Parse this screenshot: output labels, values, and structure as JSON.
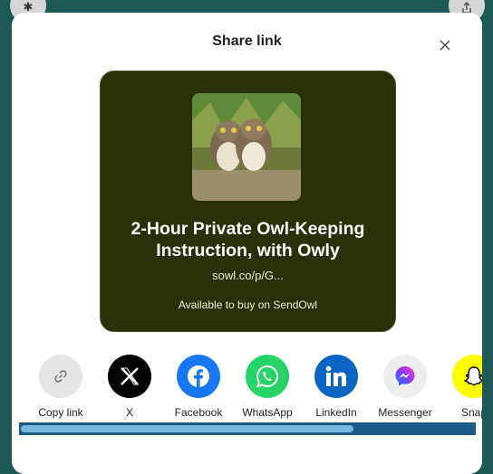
{
  "background": {
    "left_icon": "gear-icon",
    "right_icon": "share-icon"
  },
  "dialog": {
    "title": "Share link",
    "close_icon": "close-icon"
  },
  "preview": {
    "image": "owl-chicks-photo",
    "title": "2-Hour Private Owl-Keeping Instruction, with Owly",
    "url": "sowl.co/p/G...",
    "subtitle": "Available to buy on SendOwl"
  },
  "share_options": [
    {
      "label": "Copy link",
      "icon": "link-icon",
      "color": "#e2e2e2"
    },
    {
      "label": "X",
      "icon": "x-logo-icon",
      "color": "#000000"
    },
    {
      "label": "Facebook",
      "icon": "facebook-icon",
      "color": "#1877f2"
    },
    {
      "label": "WhatsApp",
      "icon": "whatsapp-icon",
      "color": "#25d366"
    },
    {
      "label": "LinkedIn",
      "icon": "linkedin-icon",
      "color": "#0a66c2"
    },
    {
      "label": "Messenger",
      "icon": "messenger-icon",
      "color": "#eeeeee"
    },
    {
      "label": "Snap",
      "icon": "snapchat-icon",
      "color": "#fffc00"
    }
  ],
  "scroll_position": 0.0
}
